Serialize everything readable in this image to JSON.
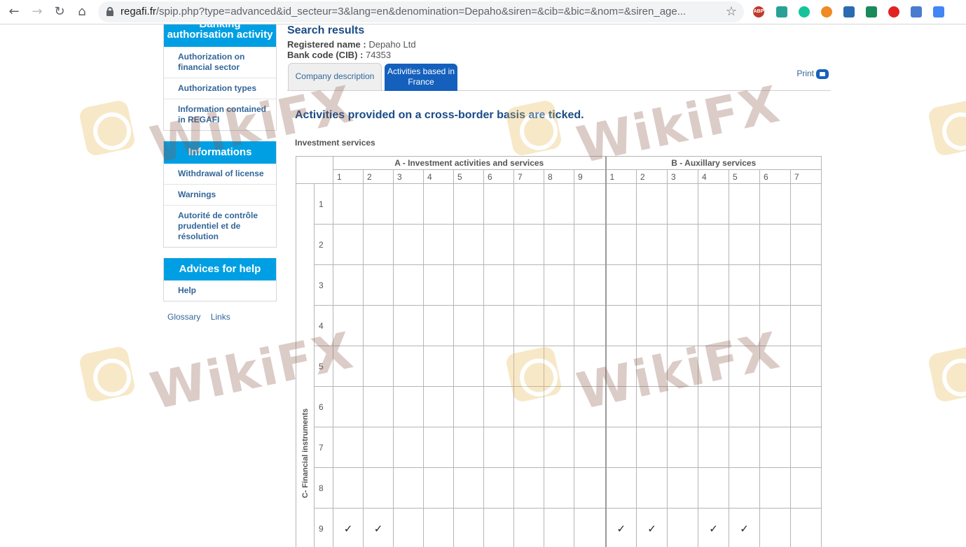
{
  "browser": {
    "url_host": "regafi.fr",
    "url_path": "/spip.php?type=advanced&id_secteur=3&lang=en&denomination=Depaho&siren=&cib=&bic=&nom=&siren_age...",
    "icons": [
      "back-icon",
      "forward-icon",
      "reload-icon",
      "home-icon",
      "lock-icon",
      "star-icon"
    ]
  },
  "sidebar": {
    "block1": {
      "title": "Banking authorisation activity",
      "items": [
        {
          "label": "Authorization on financial sector"
        },
        {
          "label": "Authorization types"
        },
        {
          "label": "Information contained in REGAFI"
        }
      ]
    },
    "block2": {
      "title": "Informations",
      "items": [
        {
          "label": "Withdrawal of license"
        },
        {
          "label": "Warnings"
        },
        {
          "label": "Autorité de contrôle prudentiel et de résolution"
        }
      ]
    },
    "block3": {
      "title": "Advices for help",
      "items": [
        {
          "label": "Help"
        }
      ]
    },
    "links": {
      "glossary": "Glossary",
      "links": "Links"
    }
  },
  "main": {
    "title": "Search results",
    "registered_label": "Registered name :",
    "registered_value": "Depaho Ltd",
    "bank_label": "Bank code (CIB) :",
    "bank_value": "74353",
    "tabs": [
      {
        "label": "Company description"
      },
      {
        "label": "Activities based in France"
      }
    ],
    "print_label": "Print",
    "lead": "Activities provided on a cross-border basis are ticked.",
    "section": "Investment services"
  },
  "grid": {
    "group_a": "A - Investment activities and services",
    "group_b": "B - Auxillary services",
    "row_label": "C- Financial instruments",
    "a_cols": [
      "1",
      "2",
      "3",
      "4",
      "5",
      "6",
      "7",
      "8",
      "9"
    ],
    "b_cols": [
      "1",
      "2",
      "3",
      "4",
      "5",
      "6",
      "7"
    ],
    "rows": [
      "1",
      "2",
      "3",
      "4",
      "5",
      "6",
      "7",
      "8",
      "9"
    ],
    "tick_mark": "✓",
    "ticks": [
      {
        "row": "9",
        "group": "A",
        "col": "1"
      },
      {
        "row": "9",
        "group": "A",
        "col": "2"
      },
      {
        "row": "9",
        "group": "B",
        "col": "1"
      },
      {
        "row": "9",
        "group": "B",
        "col": "2"
      },
      {
        "row": "9",
        "group": "B",
        "col": "4"
      },
      {
        "row": "9",
        "group": "B",
        "col": "5"
      }
    ]
  },
  "watermark": {
    "text": "WikiFX"
  },
  "colors": {
    "accent": "#009fe3",
    "tab_active": "#1560bd",
    "link": "#336699",
    "heading": "#1a4b86"
  }
}
